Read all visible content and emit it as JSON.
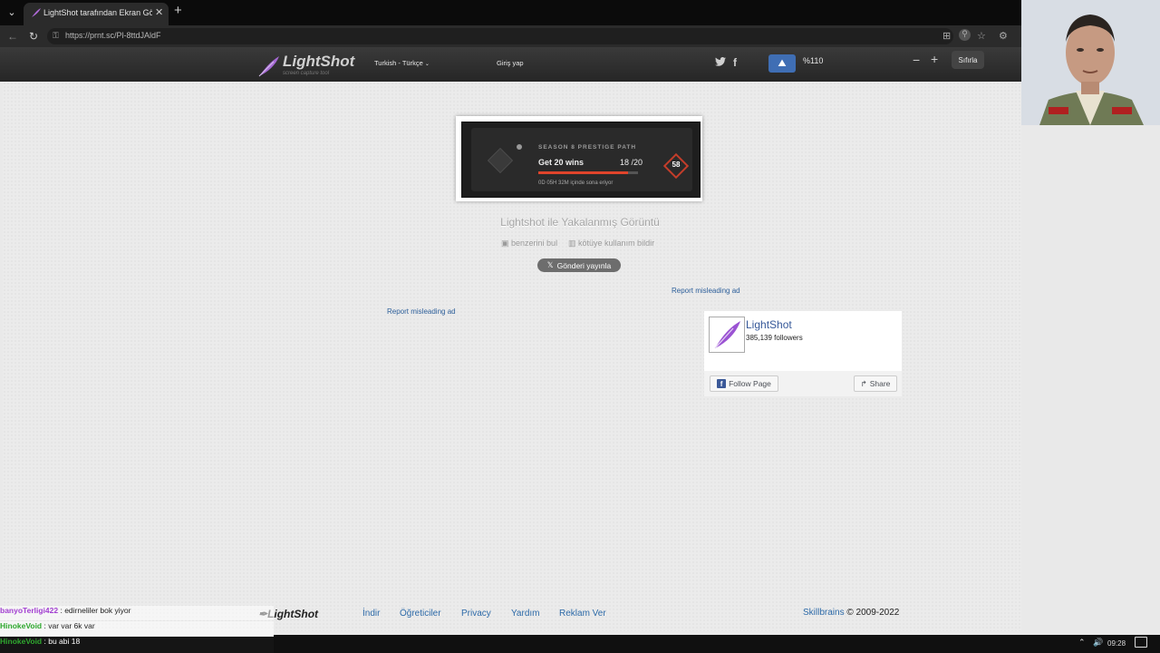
{
  "browser": {
    "tab_title": "LightShot tarafından Ekran Görünt",
    "url": "https://prnt.sc/Pl-8ttdJAldF"
  },
  "header": {
    "logo_name": "LightShot",
    "logo_tagline": "screen capture tool",
    "language": "Turkish - Türkçe",
    "login": "Giriş yap"
  },
  "zoom": {
    "level": "%110",
    "reset": "Sıfırla"
  },
  "screenshot": {
    "season": "SEASON 8 PRESTIGE PATH",
    "goal": "Get 20 wins",
    "count": "18 /20",
    "progress": 0.9,
    "expiry": "0D 05H 32M içinde sona eriyor",
    "level": "58"
  },
  "main": {
    "caption": "Lightshot ile Yakalanmış Görüntü",
    "find_similar": "benzerini bul",
    "report_abuse": "kötüye kullanım bildir",
    "tweet": "Gönderi yayınla",
    "ad_link_1": "Report misleading ad",
    "ad_link_2": "Report misleading ad"
  },
  "fb_widget": {
    "name": "LightShot",
    "followers": "385,139 followers",
    "follow": "Follow Page",
    "share": "Share"
  },
  "footer": {
    "logo": "LightShot",
    "links": [
      "İndir",
      "Öğreticiler",
      "Privacy",
      "Yardım",
      "Reklam Ver"
    ],
    "company": "Skillbrains",
    "copyright": "© 2009-2022"
  },
  "chat": [
    {
      "user": "banyoTerligi422",
      "message": ": edirneliler bok yiyor",
      "color": "#a23fd1"
    },
    {
      "user": "HinokeVoid",
      "message": ": var var 6k var",
      "color": "#2fa82f"
    },
    {
      "user": "HinokeVoid",
      "message": ": bu abi 18",
      "color": "#2fa82f"
    }
  ],
  "taskbar": {
    "time": "09:28"
  }
}
